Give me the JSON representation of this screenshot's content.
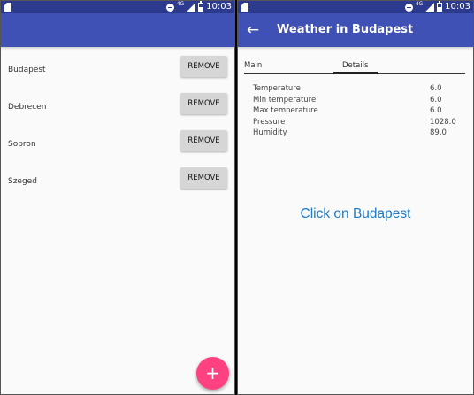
{
  "status_bar": {
    "network": "4G",
    "time": "10:03"
  },
  "left_screen": {
    "cities": [
      {
        "name": "Budapest",
        "action": "REMOVE"
      },
      {
        "name": "Debrecen",
        "action": "REMOVE"
      },
      {
        "name": "Sopron",
        "action": "REMOVE"
      },
      {
        "name": "Szeged",
        "action": "REMOVE"
      }
    ],
    "fab_label": "+"
  },
  "right_screen": {
    "title": "Weather in Budapest",
    "back_icon": "arrow-back-icon",
    "tabs": [
      {
        "label": "Main",
        "selected": false
      },
      {
        "label": "Details",
        "selected": true
      }
    ],
    "details": [
      {
        "label": "Temperature",
        "value": "6.0"
      },
      {
        "label": "Min temperature",
        "value": "6.0"
      },
      {
        "label": "Max temperature",
        "value": "6.0"
      },
      {
        "label": "Pressure",
        "value": "1028.0"
      },
      {
        "label": "Humidity",
        "value": "89.0"
      }
    ],
    "hint": "Click on Budapest"
  },
  "colors": {
    "primary": "#3f51b5",
    "primary_dark": "#2c3b8f",
    "accent": "#ff4081",
    "hint_text": "#1e7ac4"
  }
}
